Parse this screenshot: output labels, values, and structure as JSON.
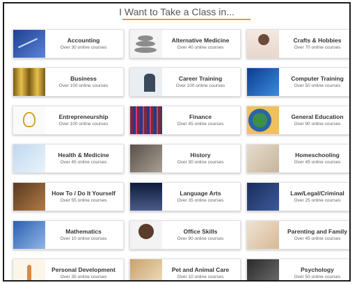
{
  "page": {
    "title": "I Want to Take a Class in..."
  },
  "categories": [
    {
      "name": "Accounting",
      "count": "Over 30 online courses",
      "icon": "accounting-photo"
    },
    {
      "name": "Alternative Medicine",
      "count": "Over 40 online courses",
      "icon": "stacked-stones-photo"
    },
    {
      "name": "Crafts & Hobbies",
      "count": "Over 70 online courses",
      "icon": "crafts-photo"
    },
    {
      "name": "Business",
      "count": "Over 100 online courses",
      "icon": "columns-photo"
    },
    {
      "name": "Career Training",
      "count": "Over 100 online courses",
      "icon": "presenter-photo"
    },
    {
      "name": "Computer Training",
      "count": "Over 50 online courses",
      "icon": "keyboard-photo"
    },
    {
      "name": "Entrepreneurship",
      "count": "Over 100 online courses",
      "icon": "light-bulb-photo"
    },
    {
      "name": "Finance",
      "count": "Over 45 online courses",
      "icon": "stock-chart-photo"
    },
    {
      "name": "General Education",
      "count": "Over 90 online courses",
      "icon": "globe-photo"
    },
    {
      "name": "Health & Medicine",
      "count": "Over 45 online courses",
      "icon": "health-photo"
    },
    {
      "name": "History",
      "count": "Over 30 online courses",
      "icon": "statue-photo"
    },
    {
      "name": "Homeschooling",
      "count": "Over 45 online courses",
      "icon": "mother-child-photo"
    },
    {
      "name": "How To / Do It Yourself",
      "count": "Over 55 online courses",
      "icon": "tools-photo"
    },
    {
      "name": "Language Arts",
      "count": "Over 35 online courses",
      "icon": "open-book-photo"
    },
    {
      "name": "Law/Legal/Criminal",
      "count": "Over 25 online courses",
      "icon": "gavel-photo"
    },
    {
      "name": "Mathematics",
      "count": "Over 10 online courses",
      "icon": "math-photo"
    },
    {
      "name": "Office Skills",
      "count": "Over 90 online courses",
      "icon": "office-worker-photo"
    },
    {
      "name": "Parenting and Family",
      "count": "Over 45 online courses",
      "icon": "family-photo"
    },
    {
      "name": "Personal Development",
      "count": "Over 35 online courses",
      "icon": "person-arms-up-photo"
    },
    {
      "name": "Pet and Animal Care",
      "count": "Over 10 online courses",
      "icon": "dog-photo"
    },
    {
      "name": "Psychology",
      "count": "Over 50 online courses",
      "icon": "brain-photo"
    }
  ]
}
